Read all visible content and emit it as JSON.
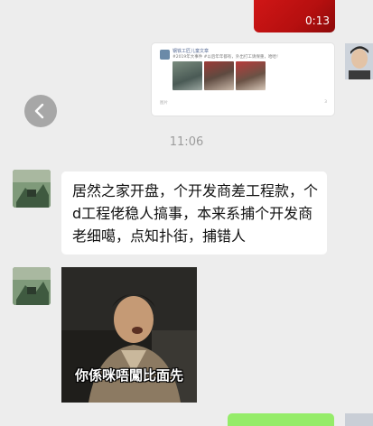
{
  "video_message": {
    "duration": "0:13"
  },
  "shared_card": {
    "title": "钢铁工匠儿童文章",
    "snippet": "#2019年大事件 #以后年年都有，外出打工请保重，哈哈！",
    "footer_left": "图片",
    "footer_right": "3"
  },
  "timestamp": "11:06",
  "incoming_text": "居然之家开盘，个开发商差工程款，个d工程佬稳人搞事，本来系捕个开发商老细噶，点知扑街，捕错人",
  "sticker": {
    "caption": "你係咪唔闖比面先"
  }
}
